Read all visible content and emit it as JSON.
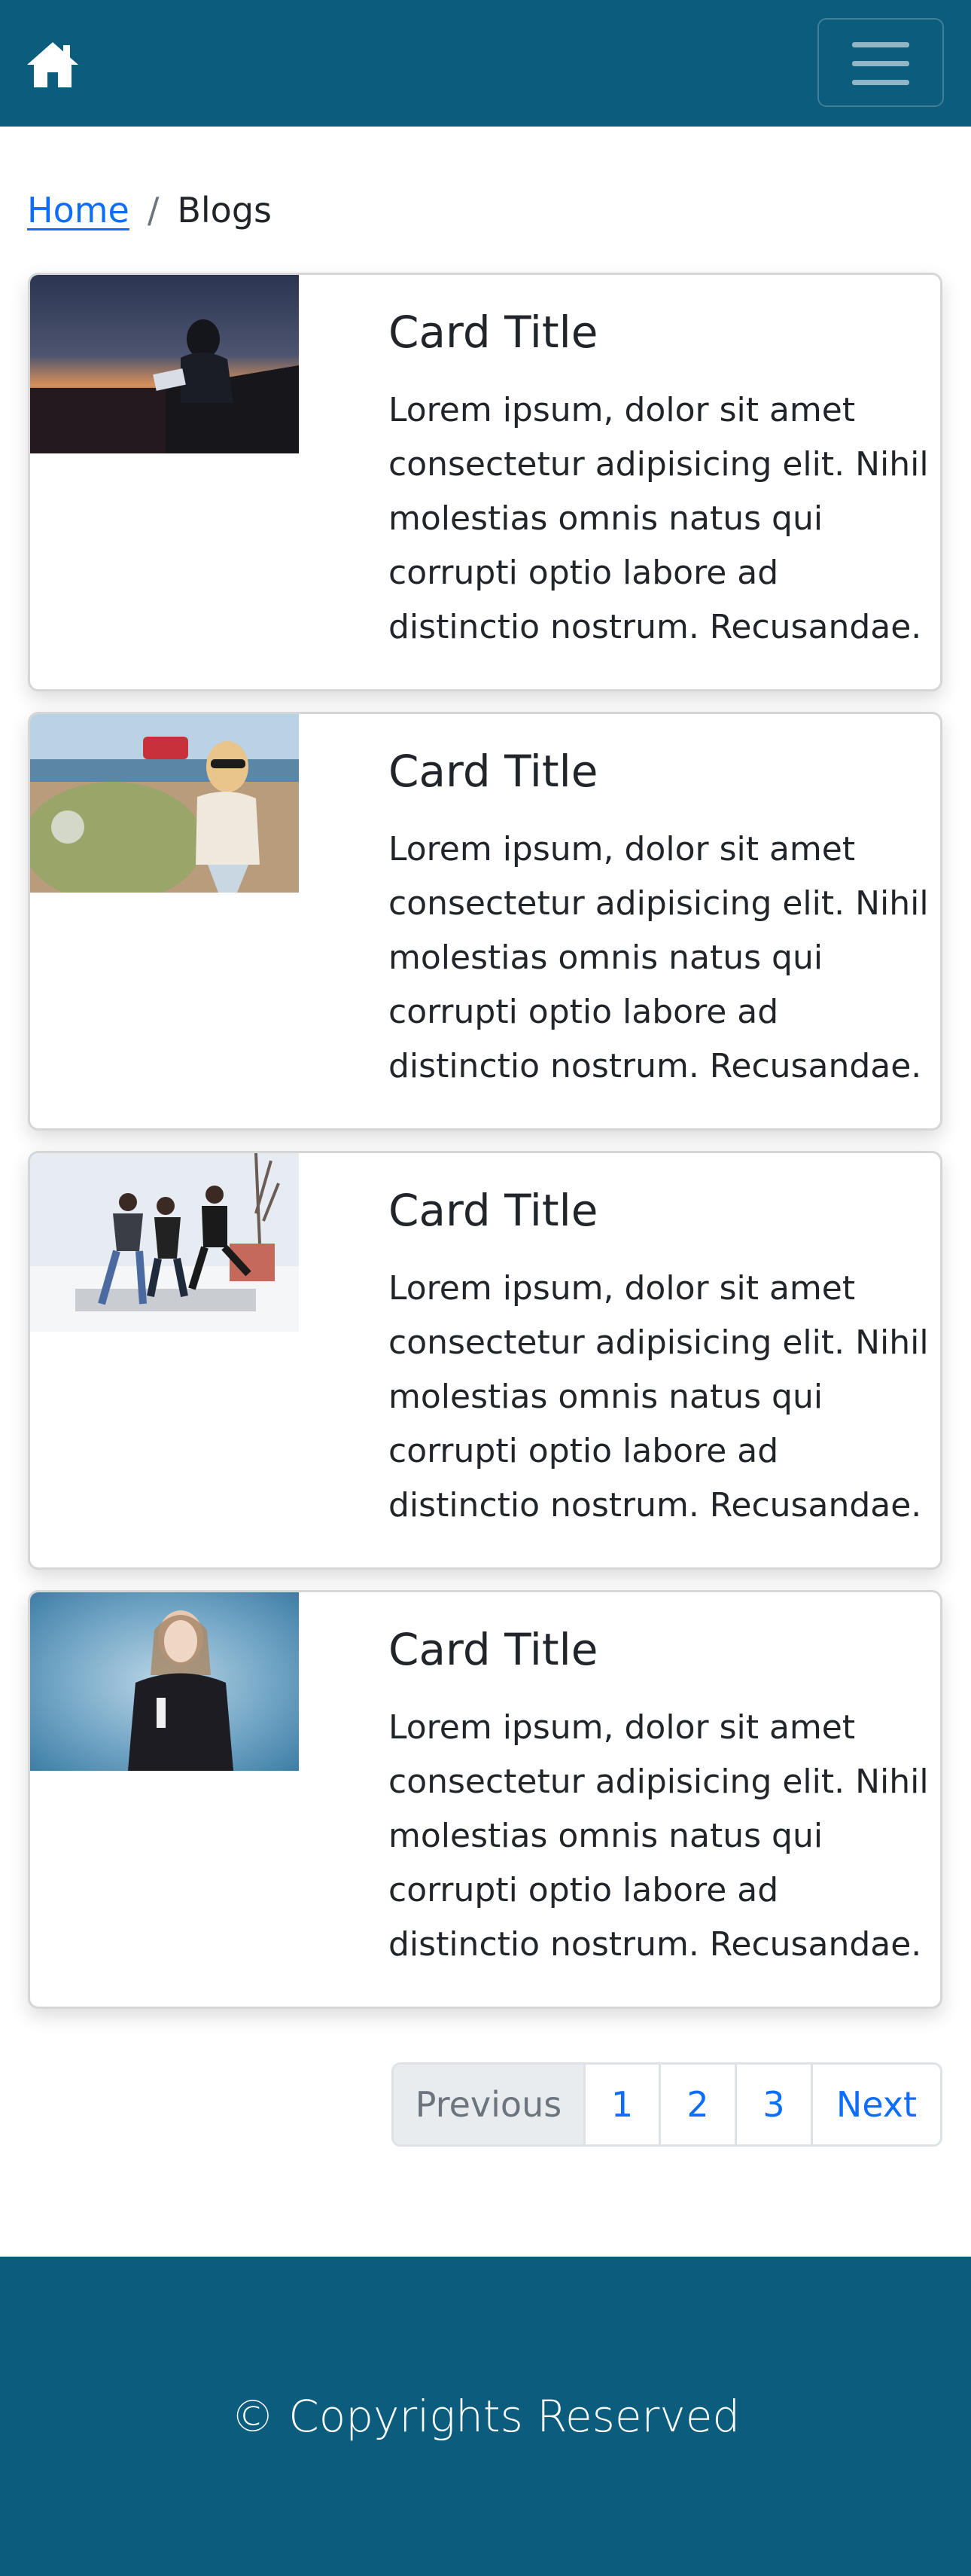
{
  "navbar": {
    "home_icon": "house-icon",
    "toggler_icon": "hamburger-menu-icon",
    "brand_color": "#0b5c7d"
  },
  "breadcrumb": {
    "home_label": "Home",
    "separator": "/",
    "current_label": "Blogs"
  },
  "cards": [
    {
      "title": "Card Title",
      "text": "Lorem ipsum, dolor sit amet consectetur adipisicing elit. Nihil molestias omnis natus qui corrupti optio labore ad distinctio nostrum. Recusandae."
    },
    {
      "title": "Card Title",
      "text": "Lorem ipsum, dolor sit amet consectetur adipisicing elit. Nihil molestias omnis natus qui corrupti optio labore ad distinctio nostrum. Recusandae."
    },
    {
      "title": "Card Title",
      "text": "Lorem ipsum, dolor sit amet consectetur adipisicing elit. Nihil molestias omnis natus qui corrupti optio labore ad distinctio nostrum. Recusandae."
    },
    {
      "title": "Card Title",
      "text": "Lorem ipsum, dolor sit amet consectetur adipisicing elit. Nihil molestias omnis natus qui corrupti optio labore ad distinctio nostrum. Recusandae."
    }
  ],
  "pagination": {
    "previous": "Previous",
    "pages": [
      "1",
      "2",
      "3"
    ],
    "next": "Next"
  },
  "footer": {
    "text": "© Copyrights Reserved"
  },
  "colors": {
    "link": "#0d6efd",
    "disabled_bg": "#e9ecef"
  }
}
